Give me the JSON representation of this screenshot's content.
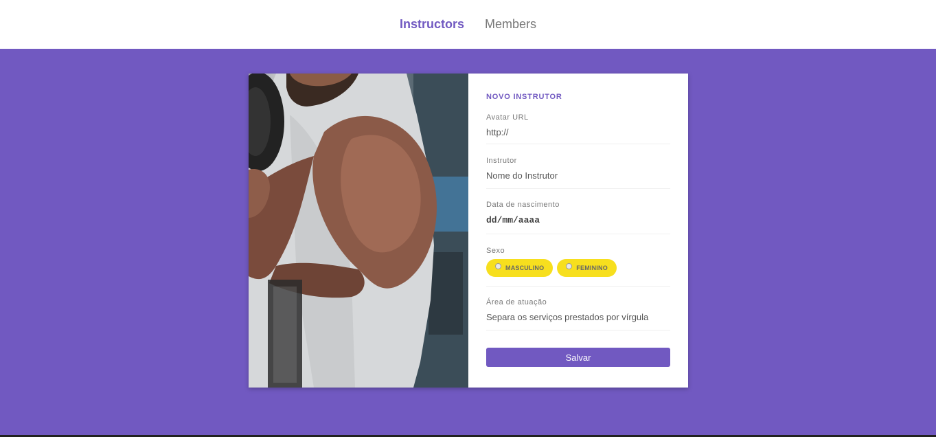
{
  "nav": {
    "instructors": "Instructors",
    "members": "Members"
  },
  "form": {
    "title": "NOVO INSTRUTOR",
    "avatar": {
      "label": "Avatar URL",
      "placeholder": "http://"
    },
    "instructor": {
      "label": "Instrutor",
      "placeholder": "Nome do Instrutor"
    },
    "birth": {
      "label": "Data de nascimento",
      "placeholder": "dd/mm/aaaa"
    },
    "gender": {
      "label": "Sexo",
      "options": [
        "MASCULINO",
        "FEMININO"
      ]
    },
    "area": {
      "label": "Área de atuação",
      "placeholder": "Separa os serviços prestados por vírgula"
    },
    "save_label": "Salvar"
  },
  "colors": {
    "accent": "#7159c1",
    "pill": "#f7df1e"
  }
}
